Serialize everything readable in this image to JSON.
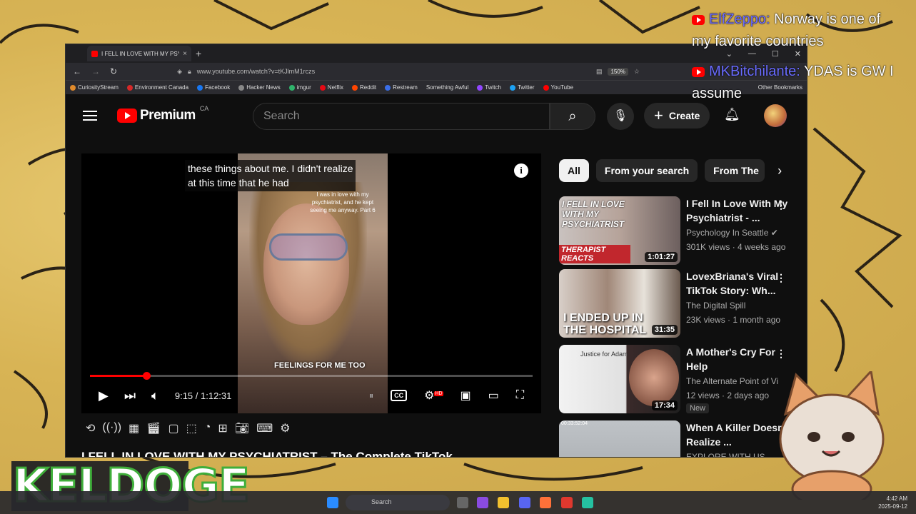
{
  "chat": [
    {
      "name": "ElfZeppo:",
      "message": "Norway is one of my favorite countries"
    },
    {
      "name": "MKBitchilante:",
      "message": "YDAS is GW I assume"
    }
  ],
  "browser": {
    "tab_title": "I FELL IN LOVE WITH MY PSYCH",
    "url": "www.youtube.com/watch?v=tKJlmM1rczs",
    "zoom": "150%",
    "bookmarks": [
      "CuriosityStream",
      "Environment Canada",
      "Facebook",
      "Hacker News",
      "imgur",
      "Netflix",
      "Reddit",
      "Restream",
      "Something Awful",
      "Twitch",
      "Twitter",
      "YouTube"
    ],
    "other_bookmarks": "Other Bookmarks"
  },
  "youtube": {
    "logo": "Premium",
    "region": "CA",
    "search_placeholder": "Search",
    "create_label": "Create"
  },
  "player": {
    "subtitle_line1": "these things about me. I didn't realize",
    "subtitle_line2": "at this time that he had",
    "video_overlay_text": "I was in love with my psychiatrist, and he kept seeing me anyway. Part 6",
    "caption_sticker": "FEELINGS FOR ME TOO",
    "time": "9:15 / 1:12:31",
    "progress": 0.127,
    "hd": "HD",
    "cc": "CC",
    "title": "I FELL IN LOVE WITH MY PSYCHIATRIST – The Complete TikTok"
  },
  "chips": [
    "All",
    "From your search",
    "From The"
  ],
  "recommendations": [
    {
      "title": "I Fell In Love With My Psychiatrist - ...",
      "channel": "Psychology In Seattle",
      "meta": "301K views · 4 weeks ago",
      "duration": "1:01:27"
    },
    {
      "title": "LovexBriana's Viral TikTok Story: Wh...",
      "channel": "The Digital Spill",
      "meta": "23K views · 1 month ago",
      "duration": "31:35"
    },
    {
      "title": "A Mother's Cry For Help",
      "channel": "The Alternate Point of Vi",
      "meta": "12 views · 2 days ago",
      "duration": "17:34",
      "badge": "New"
    },
    {
      "title": "When A Killer Doesn't Realize ...",
      "channel": "EXPLORE WITH US"
    }
  ],
  "thumb_text": {
    "t1_top": "I FELL IN LOVE WITH MY PSYCHIATRIST",
    "t1_bottom": "THERAPIST REACTS",
    "t2": "I ENDED UP IN THE HOSPITAL",
    "t3": "Justice for Adam",
    "t4_time": "00:33:52:04"
  },
  "overlay_brand": "KELDOGE",
  "taskbar": {
    "search": "Search",
    "time": "4:42 AM",
    "date": "2025-09-12"
  }
}
